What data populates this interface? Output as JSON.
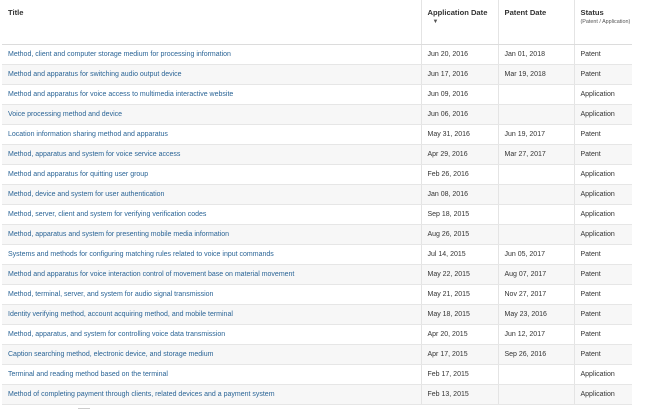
{
  "header": {
    "title": "Title",
    "application_date": "Application Date",
    "patent_date": "Patent Date",
    "status": "Status",
    "status_sub": "(Patent / Application)"
  },
  "rows": [
    {
      "title": "Method, client and computer storage medium for processing information",
      "application_date": "Jun 20, 2016",
      "patent_date": "Jan 01, 2018",
      "status": "Patent"
    },
    {
      "title": "Method and apparatus for switching audio output device",
      "application_date": "Jun 17, 2016",
      "patent_date": "Mar 19, 2018",
      "status": "Patent"
    },
    {
      "title": "Method and apparatus for voice access to multimedia interactive website",
      "application_date": "Jun 09, 2016",
      "patent_date": "",
      "status": "Application"
    },
    {
      "title": "Voice processing method and device",
      "application_date": "Jun 06, 2016",
      "patent_date": "",
      "status": "Application"
    },
    {
      "title": "Location information sharing method and apparatus",
      "application_date": "May 31, 2016",
      "patent_date": "Jun 19, 2017",
      "status": "Patent"
    },
    {
      "title": "Method, apparatus and system for voice service access",
      "application_date": "Apr 29, 2016",
      "patent_date": "Mar 27, 2017",
      "status": "Patent"
    },
    {
      "title": "Method and apparatus for quitting user group",
      "application_date": "Feb 26, 2016",
      "patent_date": "",
      "status": "Application"
    },
    {
      "title": "Method, device and system for user authentication",
      "application_date": "Jan 08, 2016",
      "patent_date": "",
      "status": "Application"
    },
    {
      "title": "Method, server, client and system for verifying verification codes",
      "application_date": "Sep 18, 2015",
      "patent_date": "",
      "status": "Application"
    },
    {
      "title": "Method, apparatus and system for presenting mobile media information",
      "application_date": "Aug 26, 2015",
      "patent_date": "",
      "status": "Application"
    },
    {
      "title": "Systems and methods for configuring matching rules related to voice input commands",
      "application_date": "Jul 14, 2015",
      "patent_date": "Jun 05, 2017",
      "status": "Patent"
    },
    {
      "title": "Method and apparatus for voice interaction control of movement base on material movement",
      "application_date": "May 22, 2015",
      "patent_date": "Aug 07, 2017",
      "status": "Patent"
    },
    {
      "title": "Method, terminal, server, and system for audio signal transmission",
      "application_date": "May 21, 2015",
      "patent_date": "Nov 27, 2017",
      "status": "Patent"
    },
    {
      "title": "Identity verifying method, account acquiring method, and mobile terminal",
      "application_date": "May 18, 2015",
      "patent_date": "May 23, 2016",
      "status": "Patent"
    },
    {
      "title": "Method, apparatus, and system for controlling voice data transmission",
      "application_date": "Apr 20, 2015",
      "patent_date": "Jun 12, 2017",
      "status": "Patent"
    },
    {
      "title": "Caption searching method, electronic device, and storage medium",
      "application_date": "Apr 17, 2015",
      "patent_date": "Sep 26, 2016",
      "status": "Patent"
    },
    {
      "title": "Terminal and reading method based on the terminal",
      "application_date": "Feb 17, 2015",
      "patent_date": "",
      "status": "Application"
    },
    {
      "title": "Method of completing payment through clients, related devices and a payment system",
      "application_date": "Feb 13, 2015",
      "patent_date": "",
      "status": "Application"
    }
  ]
}
